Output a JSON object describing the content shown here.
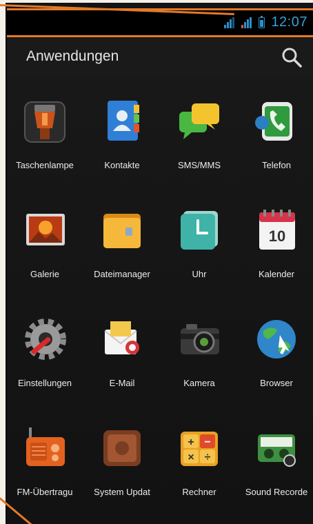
{
  "status_bar": {
    "time": "12:07"
  },
  "header": {
    "title": "Anwendungen"
  },
  "apps": [
    {
      "label": "Taschenlampe",
      "icon": "flashlight-icon"
    },
    {
      "label": "Kontakte",
      "icon": "contacts-icon"
    },
    {
      "label": "SMS/MMS",
      "icon": "messaging-icon"
    },
    {
      "label": "Telefon",
      "icon": "phone-icon"
    },
    {
      "label": "Galerie",
      "icon": "gallery-icon"
    },
    {
      "label": "Dateimanager",
      "icon": "folder-icon"
    },
    {
      "label": "Uhr",
      "icon": "clock-icon"
    },
    {
      "label": "Kalender",
      "icon": "calendar-icon",
      "badge": "10"
    },
    {
      "label": "Einstellungen",
      "icon": "settings-icon"
    },
    {
      "label": "E-Mail",
      "icon": "email-icon"
    },
    {
      "label": "Kamera",
      "icon": "camera-icon"
    },
    {
      "label": "Browser",
      "icon": "browser-globe-icon"
    },
    {
      "label": "FM-Übertragu",
      "icon": "radio-icon"
    },
    {
      "label": "System Updat",
      "icon": "system-update-icon"
    },
    {
      "label": "Rechner",
      "icon": "calculator-icon"
    },
    {
      "label": "Sound Recorde",
      "icon": "sound-recorder-icon"
    }
  ],
  "colors": {
    "accent": "#39a1d6",
    "annotation": "#e27a2a",
    "background": "#141414"
  }
}
